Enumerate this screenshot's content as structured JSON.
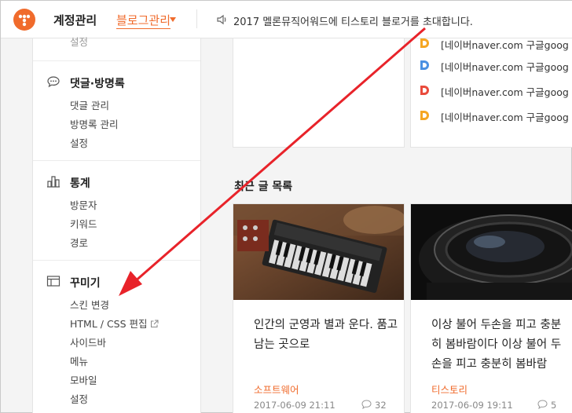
{
  "header": {
    "title": "계정관리",
    "blog_menu": "블로그관리",
    "notice": "2017 멜론뮤직어워드에 티스토리 블로거를 초대합니다."
  },
  "sidebar": {
    "top_cut_item": "설정",
    "comments": {
      "title": "댓글·방명록",
      "items": [
        "댓글 관리",
        "방명록 관리",
        "설정"
      ]
    },
    "stats": {
      "title": "통계",
      "items": [
        "방문자",
        "키워드",
        "경로"
      ]
    },
    "decorate": {
      "title": "꾸미기",
      "items": [
        "스킨 변경",
        "HTML / CSS 편집",
        "사이드바",
        "메뉴",
        "모바일",
        "설정"
      ]
    }
  },
  "referrers": [
    "[네이버naver.com 구글goog",
    "[네이버naver.com 구글goog",
    "[네이버naver.com 구글goog",
    "[네이버naver.com 구글goog"
  ],
  "recent": {
    "title": "최근 글 목록",
    "posts": [
      {
        "title": "인간의 군영과 별과 운다. 품고 남는 곳으로",
        "category": "소프트웨어",
        "date": "2017-06-09 21:11",
        "comments": "32"
      },
      {
        "title": "이상 불어 두손을 피고 충분히 봄바람이다 이상 불어 두손을 피고 충분히 봄바람",
        "category": "티스토리",
        "date": "2017-06-09 19:11",
        "comments": "5"
      }
    ]
  },
  "colors": {
    "accent": "#f06b2c",
    "arrow": "#e8232a"
  }
}
